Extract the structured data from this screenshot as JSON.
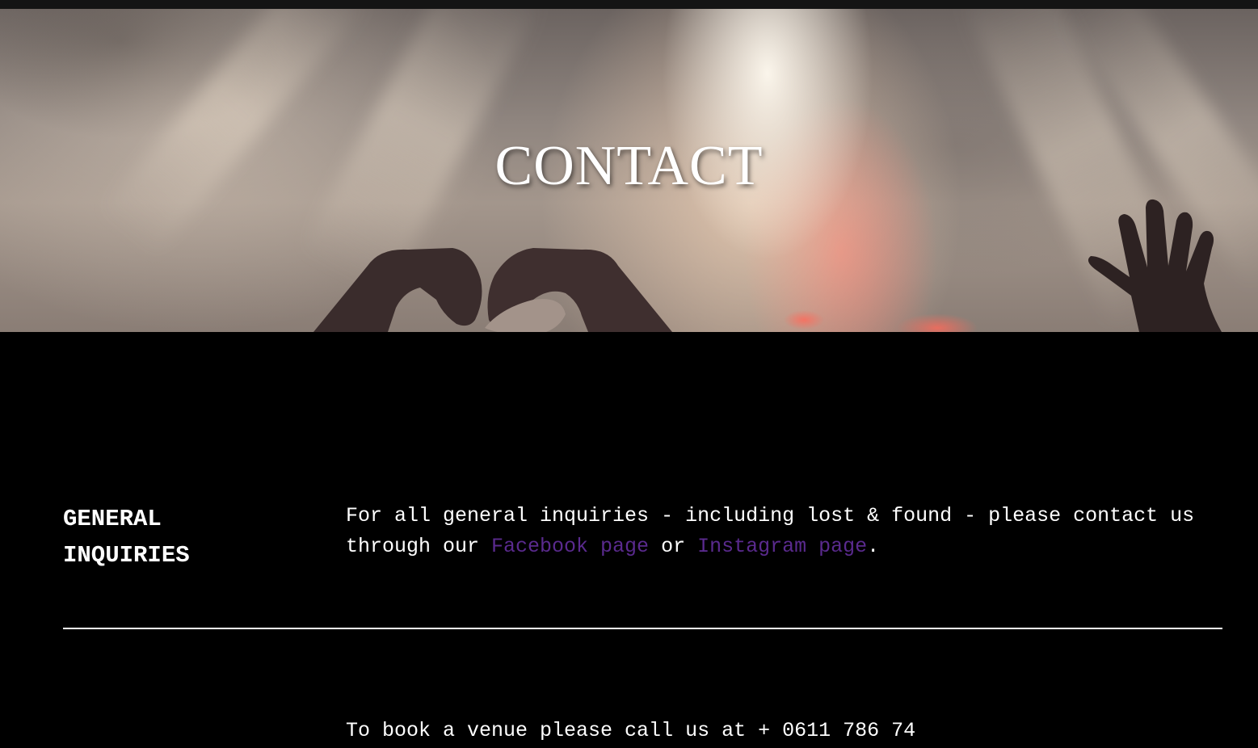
{
  "hero": {
    "title": "CONTACT"
  },
  "general_inquiries": {
    "heading_line1": "GENERAL",
    "heading_line2": "INQUIRIES",
    "text_before": "For all general inquiries - including lost & found - please contact us through our ",
    "facebook_link": "Facebook page",
    "text_middle": " or ",
    "instagram_link": "Instagram page",
    "text_after": "."
  },
  "booking": {
    "text": "To book a venue please call us at + 0611 786 74"
  },
  "colors": {
    "background": "#000000",
    "text": "#ffffff",
    "link": "#5a2a8e"
  }
}
